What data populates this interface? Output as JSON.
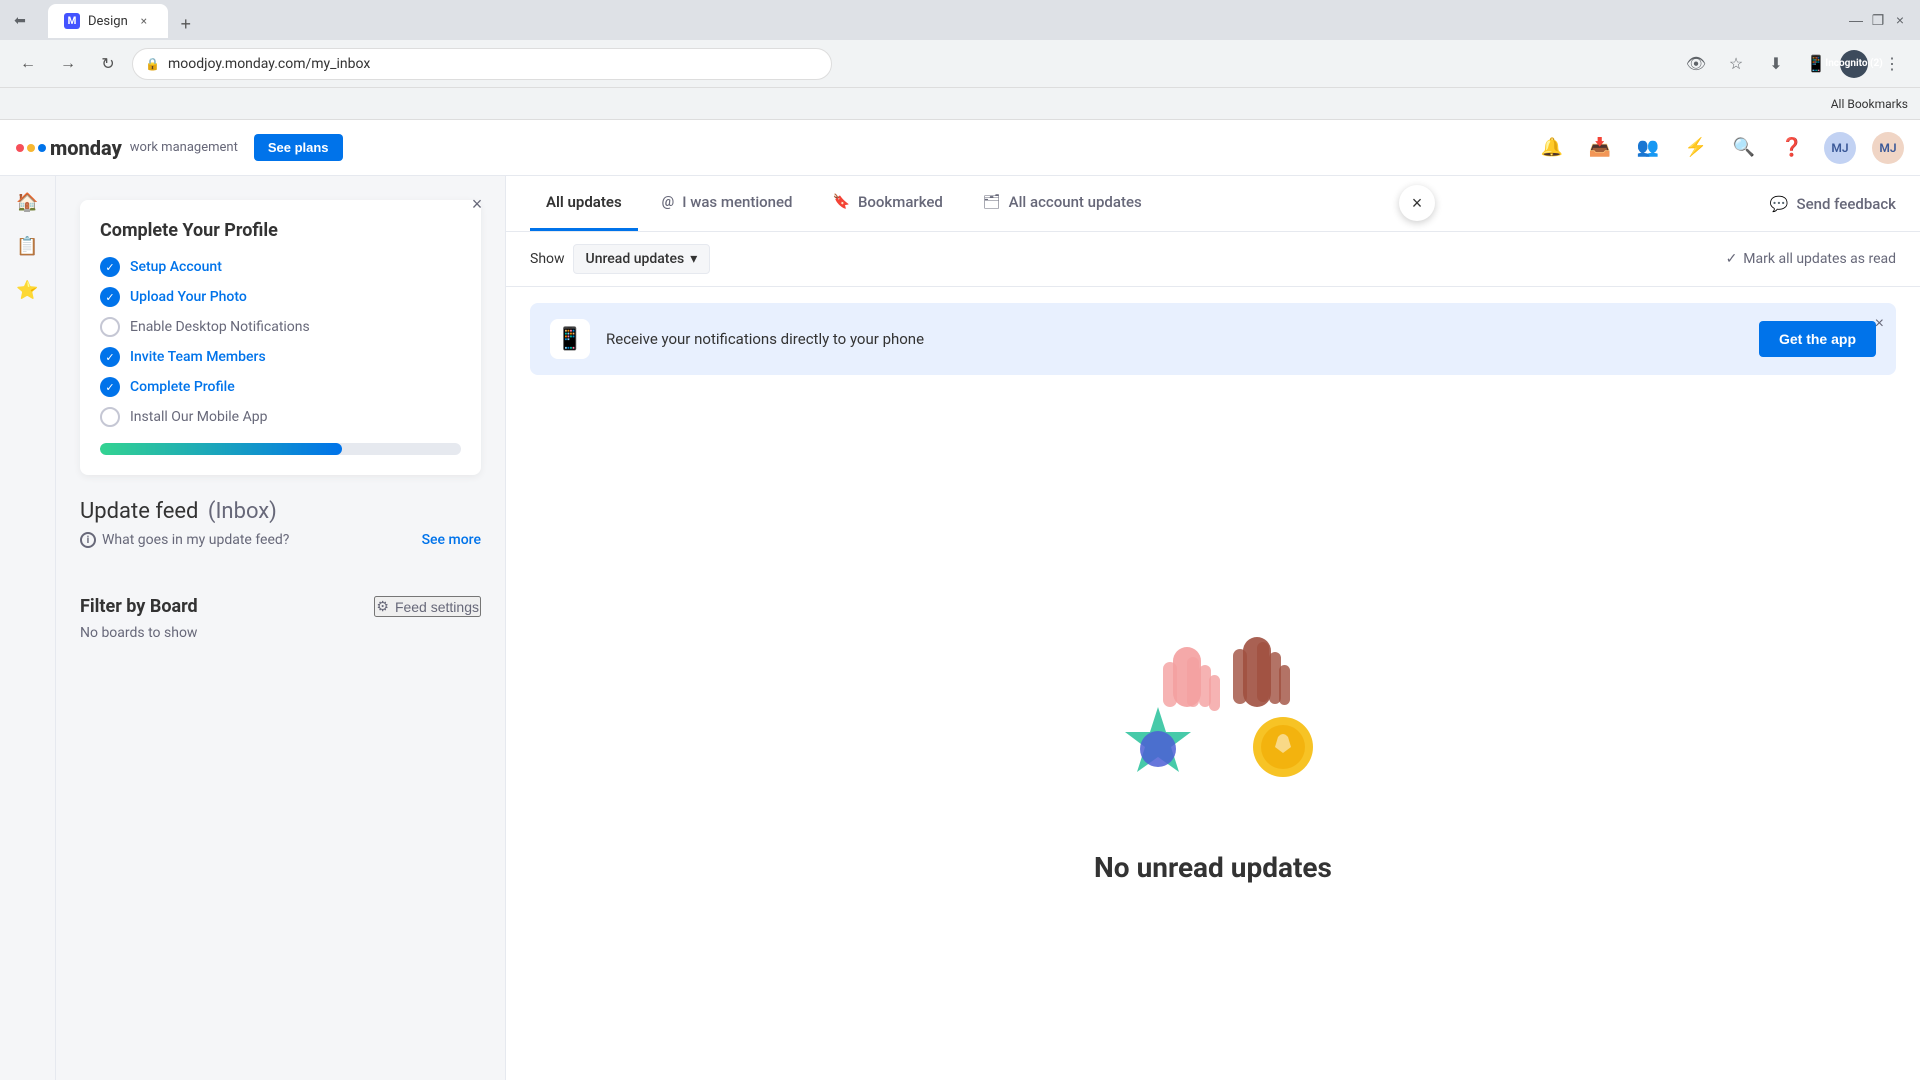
{
  "browser": {
    "tab_title": "Design",
    "url": "moodjoy.monday.com/my_inbox",
    "incognito_label": "Incognito (2)",
    "bookmarks_label": "All Bookmarks",
    "new_tab_symbol": "+"
  },
  "app_header": {
    "logo_text": "monday",
    "logo_sub": "work management",
    "see_plans_label": "See plans"
  },
  "profile_panel": {
    "close_symbol": "×",
    "complete_title": "Complete Your Profile",
    "items": [
      {
        "label": "Setup Account",
        "completed": true
      },
      {
        "label": "Upload Your Photo",
        "completed": true
      },
      {
        "label": "Enable Desktop Notifications",
        "completed": false
      },
      {
        "label": "Invite Team Members",
        "completed": true
      },
      {
        "label": "Complete Profile",
        "completed": true
      },
      {
        "label": "Install Our Mobile App",
        "completed": false
      }
    ],
    "progress_percent": 67,
    "update_feed_title": "Update feed",
    "update_feed_paren": "(Inbox)",
    "feed_info_text": "What goes in my update feed?",
    "see_more_label": "See more",
    "filter_title": "Filter by Board",
    "feed_settings_label": "Feed settings",
    "no_boards_text": "No boards to show"
  },
  "inbox": {
    "tabs": [
      {
        "label": "All updates",
        "active": true,
        "icon": ""
      },
      {
        "label": "I was mentioned",
        "active": false,
        "icon": "@"
      },
      {
        "label": "Bookmarked",
        "active": false,
        "icon": "🔖"
      },
      {
        "label": "All account updates",
        "active": false,
        "icon": "🗂"
      }
    ],
    "send_feedback_label": "Send feedback",
    "show_label": "Show",
    "filter_label": "Unread updates",
    "filter_chevron": "▾",
    "mark_all_label": "Mark all updates as read",
    "banner_text": "Receive your notifications directly to your phone",
    "get_app_label": "Get the app",
    "empty_title": "No unread updates"
  },
  "dialog_close": "×"
}
